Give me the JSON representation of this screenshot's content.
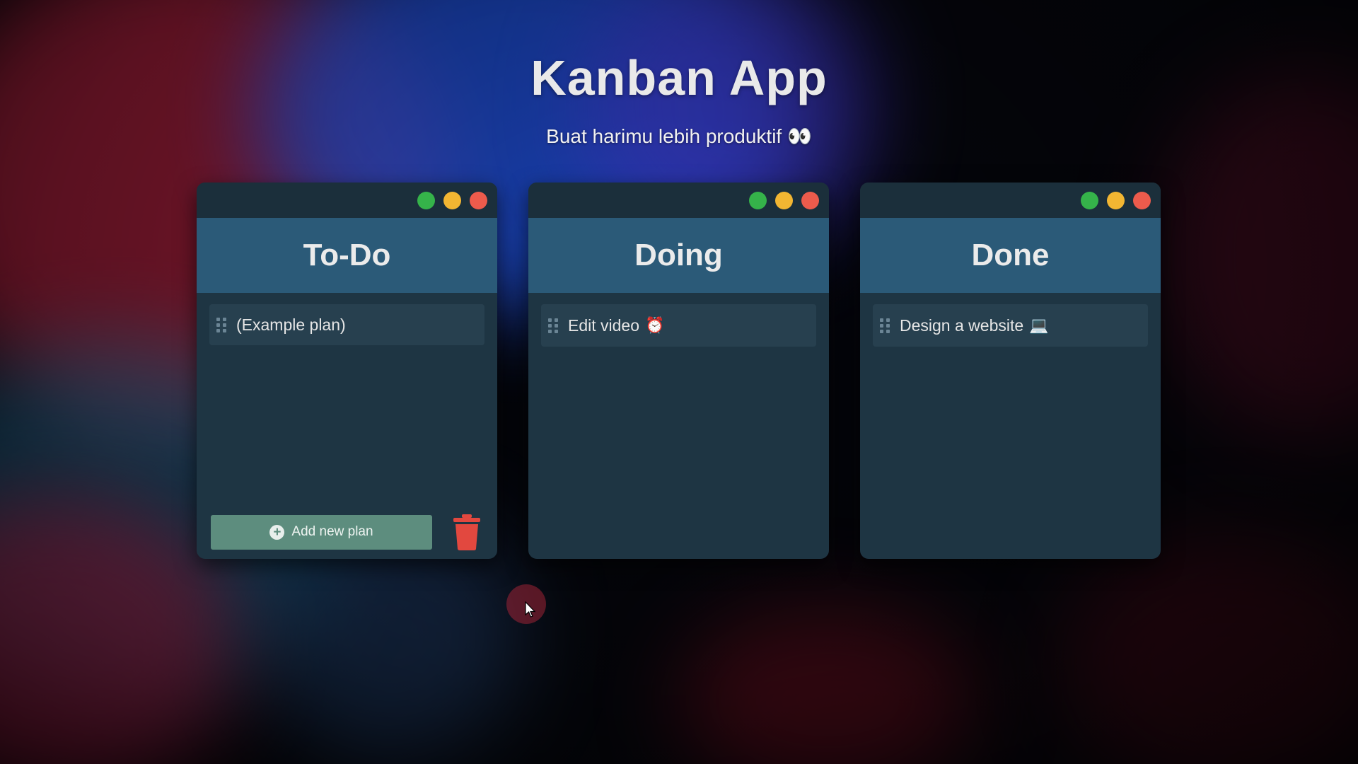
{
  "app": {
    "title": "Kanban App",
    "subtitle": "Buat harimu lebih produktif 👀"
  },
  "window_controls": {
    "colors": {
      "green": "#35b34a",
      "yellow": "#f2b632",
      "red": "#ec5b4c"
    }
  },
  "columns": [
    {
      "title": "To-Do",
      "items": [
        {
          "text": "(Example plan)",
          "emoji": ""
        }
      ],
      "footer": {
        "add_label": "Add new plan",
        "add_icon": "plus-circle-icon",
        "delete_icon": "trash-icon",
        "trash_color": "#e2483f"
      }
    },
    {
      "title": "Doing",
      "items": [
        {
          "text": "Edit video",
          "emoji": "⏰"
        }
      ]
    },
    {
      "title": "Done",
      "items": [
        {
          "text": "Design a website",
          "emoji": "💻"
        }
      ]
    }
  ]
}
